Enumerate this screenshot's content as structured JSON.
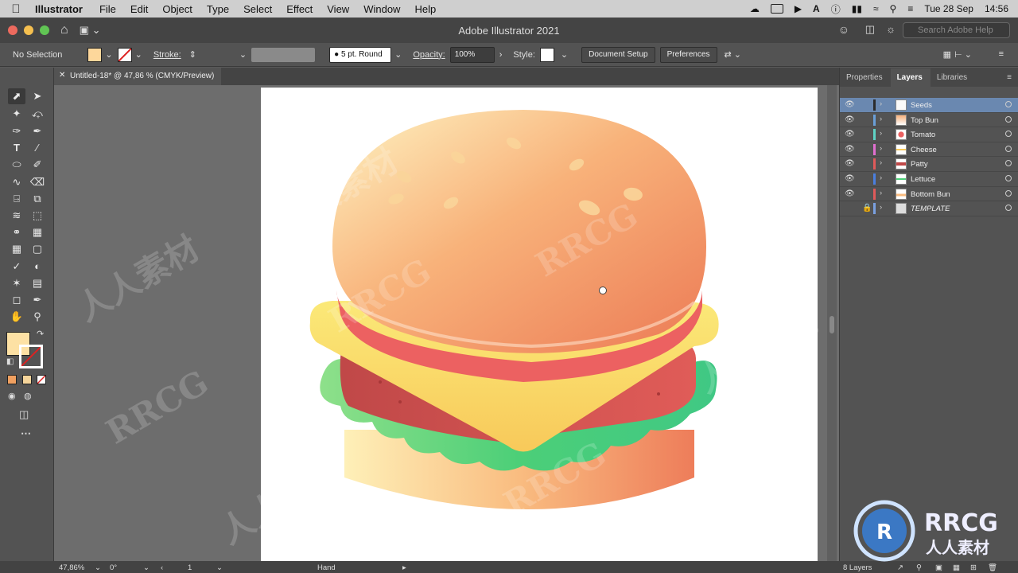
{
  "menubar": {
    "app_name": "Illustrator",
    "items": [
      "File",
      "Edit",
      "Object",
      "Type",
      "Select",
      "Effect",
      "View",
      "Window",
      "Help"
    ],
    "date": "Tue 28 Sep",
    "time": "14:56"
  },
  "titlebar": {
    "title": "Adobe Illustrator 2021",
    "search_placeholder": "Search Adobe Help"
  },
  "control": {
    "selection": "No Selection",
    "stroke_label": "Stroke:",
    "brush": "5 pt. Round",
    "opacity_label": "Opacity:",
    "opacity_value": "100%",
    "style_label": "Style:",
    "document_setup": "Document Setup",
    "preferences": "Preferences"
  },
  "document_tab": {
    "label": "Untitled-18* @ 47,86 % (CMYK/Preview)"
  },
  "panel": {
    "tabs": [
      "Properties",
      "Layers",
      "Libraries"
    ],
    "layers": [
      {
        "name": "Seeds",
        "color": "#2b2b2b",
        "selected": true
      },
      {
        "name": "Top Bun",
        "color": "#6a9fd8"
      },
      {
        "name": "Tomato",
        "color": "#5fd3c5"
      },
      {
        "name": "Cheese",
        "color": "#e06fd0"
      },
      {
        "name": "Patty",
        "color": "#e05a5a"
      },
      {
        "name": "Lettuce",
        "color": "#4a7fe0"
      },
      {
        "name": "Bottom Bun",
        "color": "#e05a5a"
      },
      {
        "name": "TEMPLATE",
        "color": "#7aa0e0",
        "locked": true
      }
    ],
    "layer_count": "8 Layers"
  },
  "status": {
    "zoom": "47,86%",
    "rotation": "0°",
    "artboard": "1",
    "tool": "Hand"
  },
  "colors": {
    "fill": "#fde1a4",
    "accent": "#6a88b0"
  },
  "watermark": {
    "text_latin": "RRCG",
    "text_cjk": "人人素材"
  }
}
